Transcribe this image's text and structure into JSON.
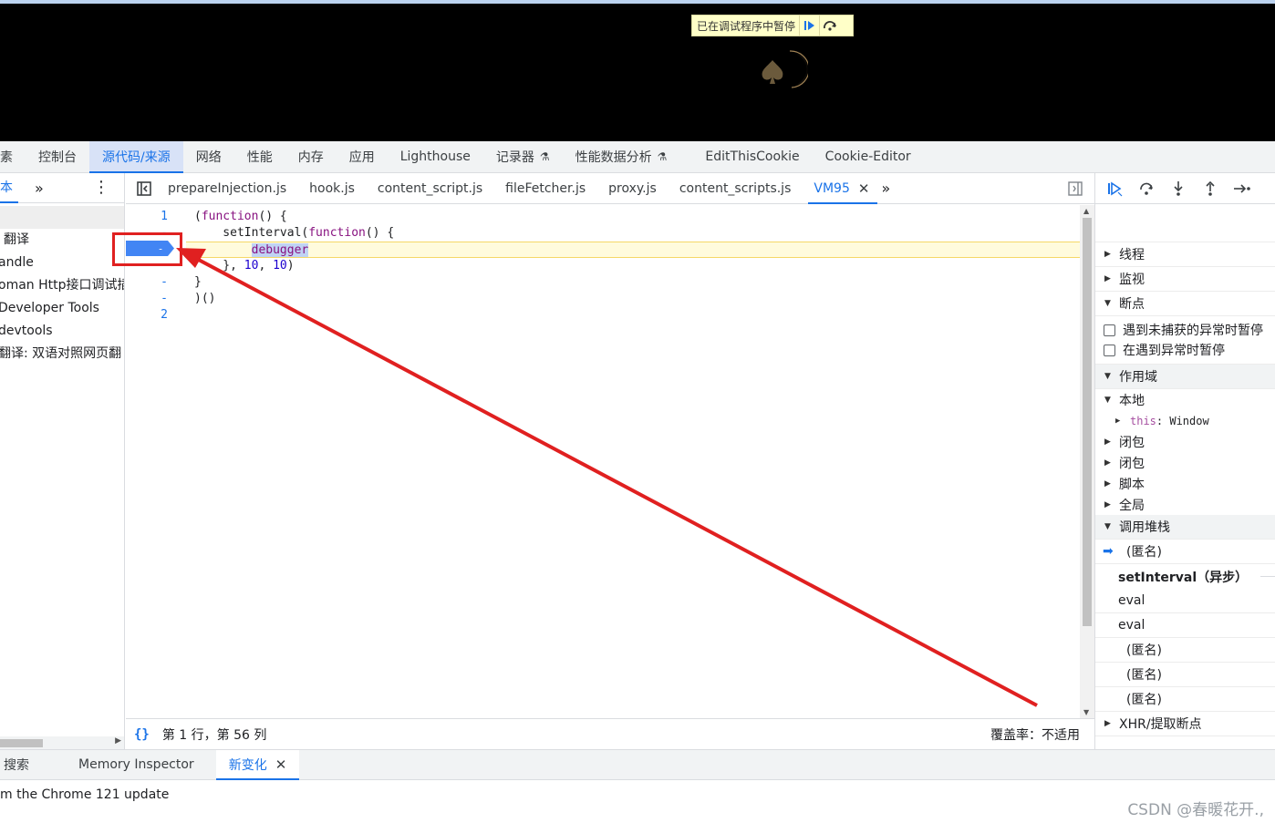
{
  "paused_overlay": {
    "text": "已在调试程序中暂停"
  },
  "main_tabs": [
    "素",
    "控制台",
    "源代码/来源",
    "网络",
    "性能",
    "内存",
    "应用",
    "Lighthouse",
    "记录器",
    "性能数据分析",
    "EditThisCookie",
    "Cookie-Editor"
  ],
  "main_tab_active": "源代码/来源",
  "navigator": {
    "tab_label": "本",
    "more_icon": "double-chevron-right-icon",
    "menu_icon": "kebab-icon",
    "items": [
      "翻译",
      "andle",
      "oman Http接口调试插",
      "Developer Tools",
      "devtools",
      "翻译: 双语对照网页翻"
    ]
  },
  "file_tabs": [
    "prepareInjection.js",
    "hook.js",
    "content_script.js",
    "fileFetcher.js",
    "proxy.js",
    "content_scripts.js",
    "VM95"
  ],
  "file_tab_active": "VM95",
  "code_lines": [
    {
      "gutter": "1",
      "parts": [
        [
          "",
          "("
        ],
        [
          "kw",
          "function"
        ],
        [
          "",
          "() {"
        ]
      ]
    },
    {
      "gutter": "-",
      "parts": [
        [
          "",
          "    setInterval("
        ],
        [
          "kw",
          "function"
        ],
        [
          "",
          "() {"
        ]
      ]
    },
    {
      "gutter": "-",
      "parts": [
        [
          "",
          "        "
        ],
        [
          "hl",
          "debugger"
        ]
      ]
    },
    {
      "gutter": "-",
      "parts": [
        [
          "",
          "    }, "
        ],
        [
          "num",
          "10"
        ],
        [
          "",
          ", "
        ],
        [
          "num",
          "10"
        ],
        [
          "",
          ")"
        ]
      ]
    },
    {
      "gutter": "-",
      "parts": [
        [
          "",
          "}"
        ]
      ]
    },
    {
      "gutter": "-",
      "parts": [
        [
          "",
          ")()"
        ]
      ]
    },
    {
      "gutter": "2",
      "parts": []
    }
  ],
  "status_bar": {
    "braces": "{}",
    "position": "第 1 行，第 56 列",
    "coverage": "覆盖率：不适用"
  },
  "sidebar": {
    "sections_collapsed": [
      "线程",
      "监视"
    ],
    "breakpoints_header": "断点",
    "breakpoint_options": [
      "遇到未捕获的异常时暂停",
      "在遇到异常时暂停"
    ],
    "scope_header": "作用域",
    "scope_local": "本地",
    "scope_this_key": "this",
    "scope_this_value": "Window",
    "scope_others": [
      "闭包",
      "闭包",
      "脚本",
      "全局"
    ],
    "callstack_header": "调用堆栈",
    "callstack_selected": "(匿名)",
    "callstack_async": "setInterval（异步）",
    "callstack_frames": [
      "eval",
      "eval",
      "(匿名)",
      "(匿名)",
      "(匿名)"
    ],
    "xhr_header": "XHR/提取断点"
  },
  "drawer": {
    "tabs": [
      "搜索",
      "Memory Inspector",
      "新变化"
    ],
    "active": "新变化",
    "line": "m the Chrome 121 update",
    "watermark": "CSDN @春暖花开.,"
  },
  "colors": {
    "accent": "#1a73e8",
    "annotation_red": "#e02020",
    "current_line": "#fffbdd"
  }
}
